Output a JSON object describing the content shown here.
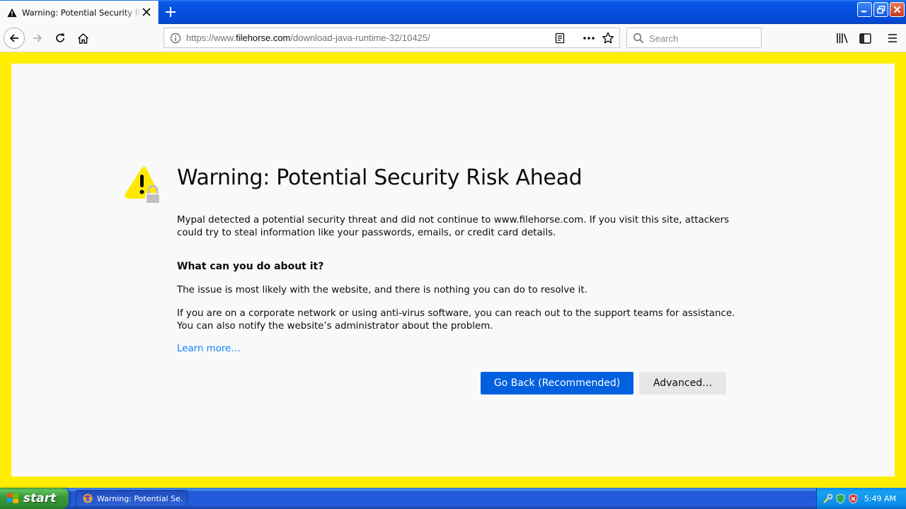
{
  "tab": {
    "title": "Warning: Potential Security Risk Ahead"
  },
  "url": {
    "prefix": "https://www.",
    "domain": "filehorse.com",
    "path": "/download-java-runtime-32/10425/"
  },
  "search": {
    "placeholder": "Search"
  },
  "error_page": {
    "heading": "Warning: Potential Security Risk Ahead",
    "intro": "Mypal detected a potential security threat and did not continue to www.filehorse.com. If you visit this site, attackers could try to steal information like your passwords, emails, or credit card details.",
    "subheading": "What can you do about it?",
    "para_site": "The issue is most likely with the website, and there is nothing you can do to resolve it.",
    "para_network": "If you are on a corporate network or using anti-virus software, you can reach out to the support teams for assistance. You can also notify the website’s administrator about the problem.",
    "learn_more": "Learn more…",
    "go_back_button": "Go Back (Recommended)",
    "advanced_button": "Advanced…"
  },
  "taskbar": {
    "start_label": "start",
    "task_label": "Warning: Potential Se...",
    "clock": "5:49 AM"
  },
  "colors": {
    "frame_highlight": "#ffee00",
    "primary_button": "#0060df",
    "link": "#0a84ff",
    "xp_blue": "#245edb",
    "start_green": "#3a9b3a"
  }
}
